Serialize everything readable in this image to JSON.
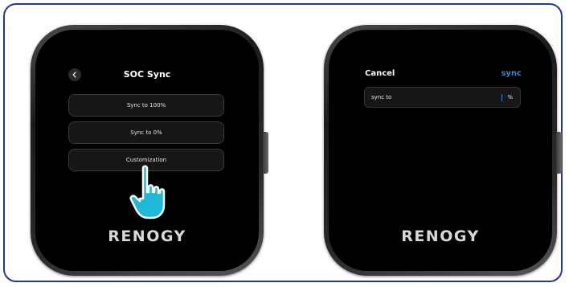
{
  "left_screen": {
    "title": "SOC Sync",
    "back_icon": "chevron-left-icon",
    "options": [
      {
        "label": "Sync to 100%"
      },
      {
        "label": "Sync to 0%"
      },
      {
        "label": "Customization"
      }
    ],
    "tap_indicator_icon": "pointing-hand-icon",
    "brand": "RENOGY"
  },
  "right_screen": {
    "cancel_label": "Cancel",
    "sync_label": "sync",
    "field": {
      "label": "sync to",
      "value": "",
      "unit": "%"
    },
    "brand": "RENOGY"
  },
  "colors": {
    "frame_border": "#223a8e",
    "accent": "#2f86d6",
    "screen_bg": "#000000",
    "hand": "#1fb8d6"
  }
}
